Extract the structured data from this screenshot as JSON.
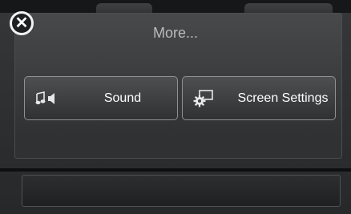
{
  "header": {
    "title": "More...",
    "close_icon": "close-x-icon"
  },
  "menu": {
    "items": [
      {
        "label": "Sound",
        "icon": "music-note-speaker-icon"
      },
      {
        "label": "Screen Settings",
        "icon": "display-gear-icon"
      }
    ]
  },
  "colors": {
    "background": "#2b2d2f",
    "panel": "#3e4042",
    "button_border": "#8f9194",
    "text": "#ffffff",
    "title_text": "#b9bbbd"
  }
}
